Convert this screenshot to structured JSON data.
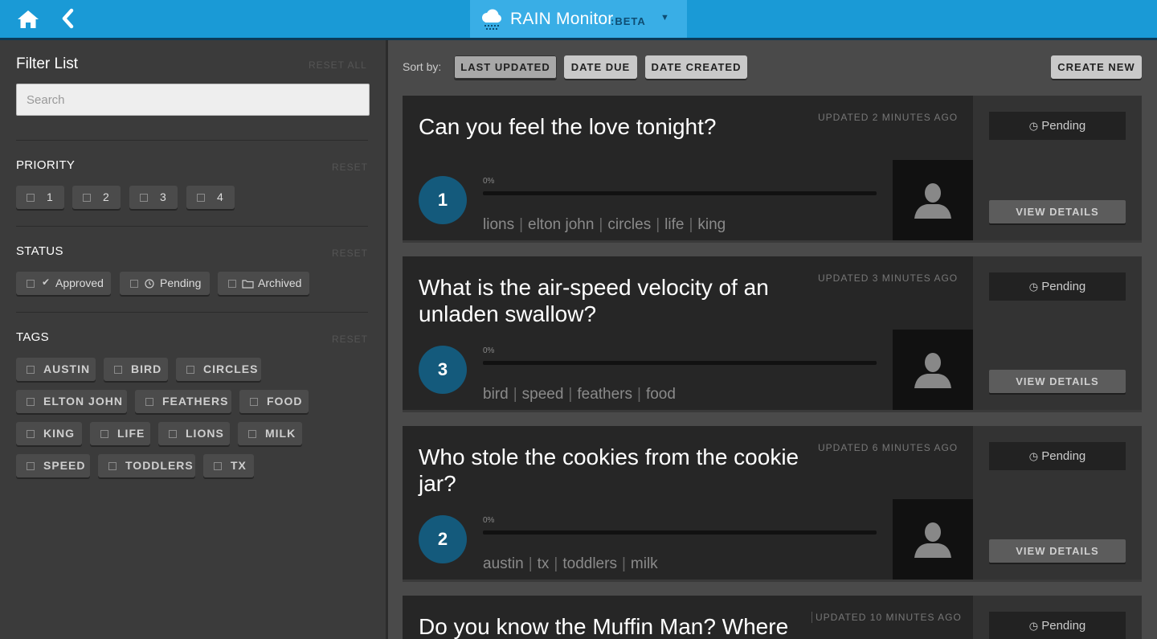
{
  "app": {
    "title": "RAIN Monitor",
    "beta": ":BETA",
    "colors": {
      "topbar": "#1a9ad6",
      "brand": "#39aee6",
      "badge": "#145a7c"
    }
  },
  "nav": {
    "home_icon": "home-icon",
    "back_icon": "chevron-left-icon",
    "dropdown_icon": "caret-down-icon"
  },
  "sidebar": {
    "title": "Filter List",
    "reset_all": "RESET ALL",
    "search_placeholder": "Search",
    "priority": {
      "heading": "PRIORITY",
      "reset": "RESET",
      "options": [
        "1",
        "2",
        "3",
        "4"
      ]
    },
    "status": {
      "heading": "STATUS",
      "reset": "RESET",
      "options": [
        {
          "label": "Approved",
          "icon": "checkmark-icon"
        },
        {
          "label": "Pending",
          "icon": "clock-icon"
        },
        {
          "label": "Archived",
          "icon": "folder-icon"
        }
      ]
    },
    "tags": {
      "heading": "TAGS",
      "reset": "RESET",
      "options": [
        "AUSTIN",
        "BIRD",
        "CIRCLES",
        "ELTON JOHN",
        "FEATHERS",
        "FOOD",
        "KING",
        "LIFE",
        "LIONS",
        "MILK",
        "SPEED",
        "TODDLERS",
        "TX"
      ]
    }
  },
  "main": {
    "sort_label": "Sort by:",
    "sort_options": [
      "LAST UPDATED",
      "DATE DUE",
      "DATE CREATED"
    ],
    "active_sort": "LAST UPDATED",
    "create_new": "CREATE NEW",
    "cards": [
      {
        "title": "Can you feel the love tonight?",
        "updated": "UPDATED 2 MINUTES AGO",
        "priority": "1",
        "progress": "0%",
        "progress_value": 0,
        "tags": [
          "lions",
          "elton john",
          "circles",
          "life",
          "king"
        ],
        "status": "Pending",
        "view_details": "VIEW DETAILS"
      },
      {
        "title": "What is the air-speed velocity of an unladen swallow?",
        "updated": "UPDATED 3 MINUTES AGO",
        "priority": "3",
        "progress": "0%",
        "progress_value": 0,
        "tags": [
          "bird",
          "speed",
          "feathers",
          "food"
        ],
        "status": "Pending",
        "view_details": "VIEW DETAILS"
      },
      {
        "title": "Who stole the cookies from the cookie jar?",
        "updated": "UPDATED 6 MINUTES AGO",
        "priority": "2",
        "progress": "0%",
        "progress_value": 0,
        "tags": [
          "austin",
          "tx",
          "toddlers",
          "milk"
        ],
        "status": "Pending",
        "view_details": "VIEW DETAILS"
      },
      {
        "title": "Do you know the Muffin Man? Where",
        "updated": "UPDATED 10 MINUTES AGO",
        "status": "Pending"
      }
    ]
  }
}
